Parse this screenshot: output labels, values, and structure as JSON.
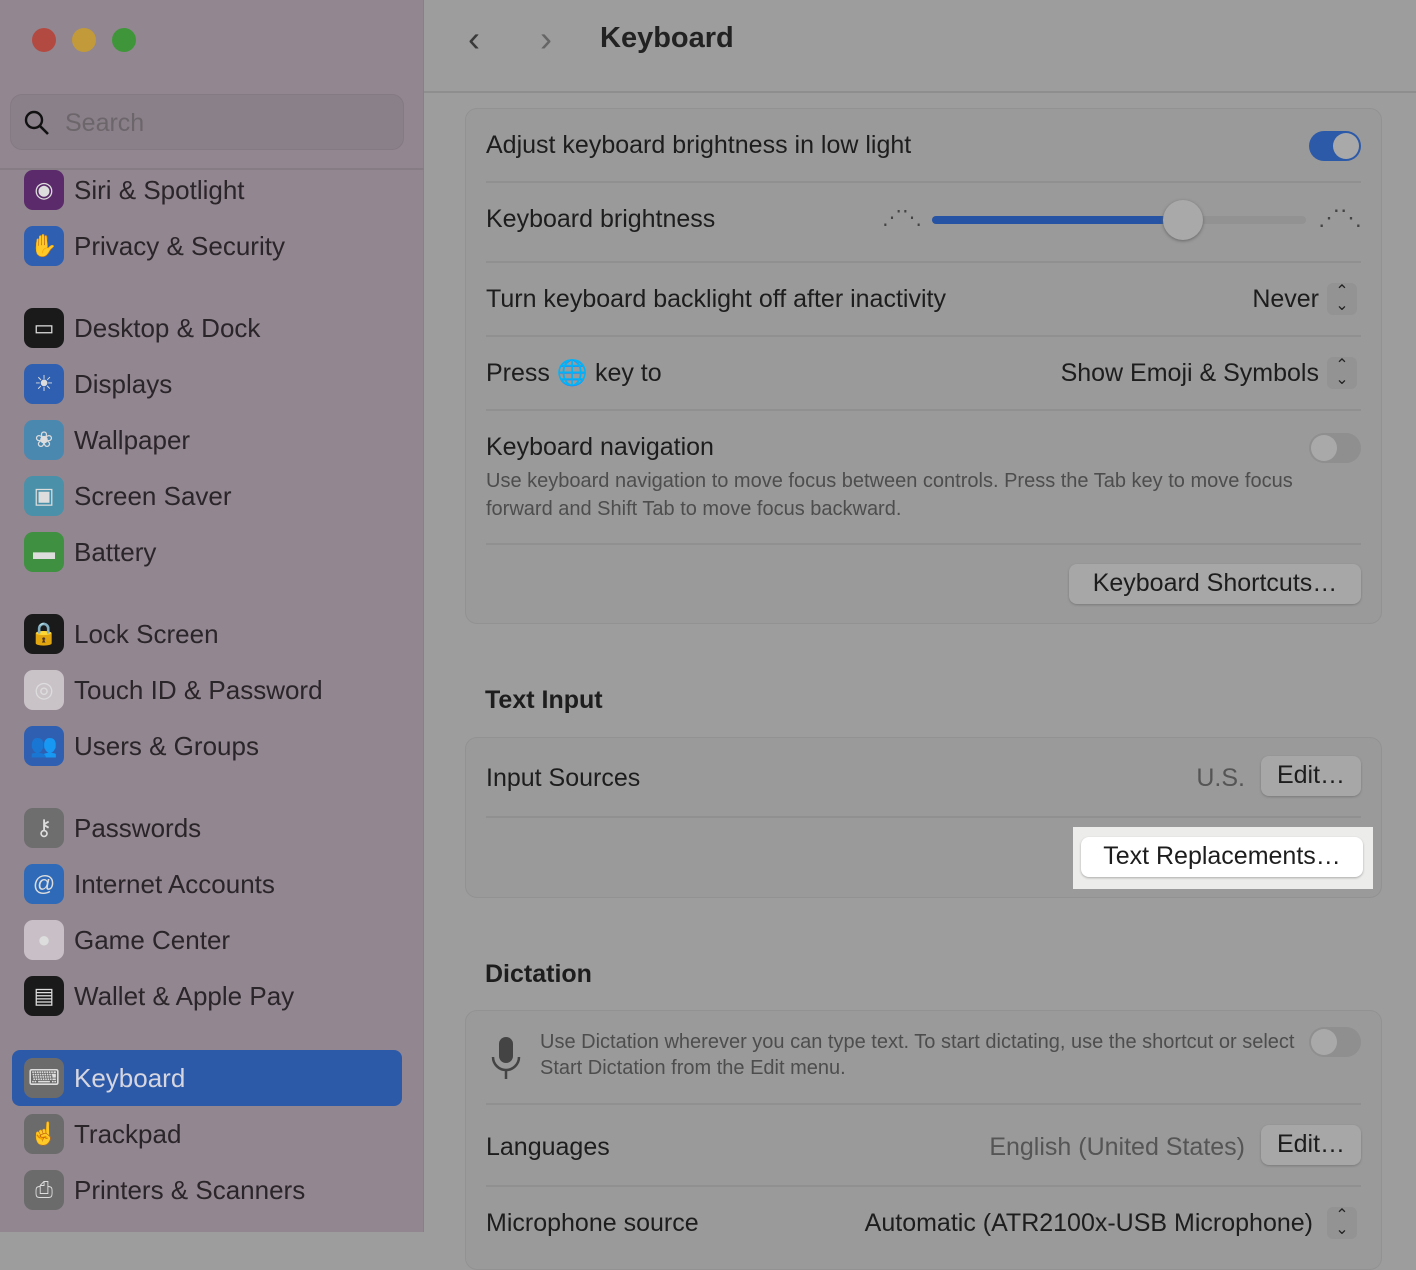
{
  "window": {
    "controls": [
      "close",
      "minimize",
      "zoom"
    ]
  },
  "search": {
    "placeholder": "Search"
  },
  "sidebar": {
    "items": [
      {
        "label": "Siri & Spotlight",
        "icon": "siri-icon",
        "color": "#5a2a6a"
      },
      {
        "label": "Privacy & Security",
        "icon": "hand-icon",
        "color": "#2f5fb0"
      },
      {
        "label": "Desktop & Dock",
        "icon": "dock-icon",
        "color": "#1a1a1a"
      },
      {
        "label": "Displays",
        "icon": "sun-icon",
        "color": "#2f5fb0"
      },
      {
        "label": "Wallpaper",
        "icon": "flower-icon",
        "color": "#4a88b0"
      },
      {
        "label": "Screen Saver",
        "icon": "screensaver-icon",
        "color": "#4a90a8"
      },
      {
        "label": "Battery",
        "icon": "battery-icon",
        "color": "#3f9040"
      },
      {
        "label": "Lock Screen",
        "icon": "lock-icon",
        "color": "#1a1a1a"
      },
      {
        "label": "Touch ID & Password",
        "icon": "fingerprint-icon",
        "color": "#c9c3c8"
      },
      {
        "label": "Users & Groups",
        "icon": "users-icon",
        "color": "#2f5fb0"
      },
      {
        "label": "Passwords",
        "icon": "key-icon",
        "color": "#6e6e6e"
      },
      {
        "label": "Internet Accounts",
        "icon": "at-icon",
        "color": "#2f6ab8"
      },
      {
        "label": "Game Center",
        "icon": "game-center-icon",
        "color": "#c8c0c6"
      },
      {
        "label": "Wallet & Apple Pay",
        "icon": "wallet-icon",
        "color": "#1a1a1a"
      },
      {
        "label": "Keyboard",
        "icon": "keyboard-icon",
        "color": "#6b6b6b",
        "selected": true
      },
      {
        "label": "Trackpad",
        "icon": "trackpad-icon",
        "color": "#6b6b6b"
      },
      {
        "label": "Printers & Scanners",
        "icon": "printer-icon",
        "color": "#6b6b6b"
      }
    ]
  },
  "header": {
    "back": "‹",
    "forward": "›",
    "title": "Keyboard"
  },
  "keyboard": {
    "adjust_brightness": {
      "label": "Adjust keyboard brightness in low light",
      "on": true
    },
    "brightness": {
      "label": "Keyboard brightness",
      "value": 0.67
    },
    "backlight": {
      "label": "Turn keyboard backlight off after inactivity",
      "value": "Never"
    },
    "globe": {
      "label_pre": "Press",
      "label_post": "key to",
      "value": "Show Emoji & Symbols"
    },
    "navigation": {
      "label": "Keyboard navigation",
      "on": false,
      "description": "Use keyboard navigation to move focus between controls. Press the Tab key to move focus forward and Shift Tab to move focus backward."
    },
    "shortcuts_button": "Keyboard Shortcuts…"
  },
  "text_input": {
    "heading": "Text Input",
    "input_sources_label": "Input Sources",
    "input_sources_value": "U.S.",
    "edit_button": "Edit…",
    "text_replacements_button": "Text Replacements…"
  },
  "dictation": {
    "heading": "Dictation",
    "description": "Use Dictation wherever you can type text. To start dictating, use the shortcut or select Start Dictation from the Edit menu.",
    "on": false,
    "languages_label": "Languages",
    "languages_value": "English (United States)",
    "edit_button": "Edit…",
    "mic_label": "Microphone source",
    "mic_value": "Automatic (ATR2100x-USB Microphone)"
  },
  "colors": {
    "accent": "#2d5aa8",
    "highlight": "#ececea"
  }
}
